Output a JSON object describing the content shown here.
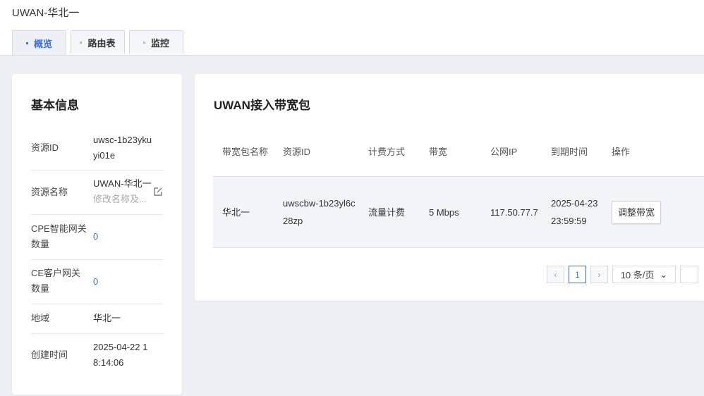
{
  "page_title": "UWAN-华北一",
  "tabs": [
    {
      "label": "概览"
    },
    {
      "label": "路由表"
    },
    {
      "label": "监控"
    }
  ],
  "basic_info": {
    "title": "基本信息",
    "resource_id_label": "资源ID",
    "resource_id_value": "uwsc-1b23ykuyi01e",
    "resource_name_label": "资源名称",
    "resource_name_value": "UWAN-华北一",
    "resource_name_hint": "修改名称及...",
    "cpe_label": "CPE智能网关数量",
    "cpe_value": "0",
    "ce_label": "CE客户网关数量",
    "ce_value": "0",
    "region_label": "地域",
    "region_value": "华北一",
    "created_label": "创建时间",
    "created_value": "2025-04-22 18:14:06"
  },
  "bandwidth": {
    "title": "UWAN接入带宽包",
    "columns": [
      "带宽包名称",
      "资源ID",
      "计费方式",
      "带宽",
      "公网IP",
      "到期时间",
      "操作"
    ],
    "rows": [
      {
        "name": "华北一",
        "resource_id": "uwscbw-1b23yl6c28zp",
        "billing": "流量计费",
        "bandwidth": "5 Mbps",
        "ip": "117.50.77.7",
        "expire": "2025-04-23 23:59:59",
        "action": "调整带宽"
      }
    ]
  },
  "pagination": {
    "page": "1",
    "page_size": "10 条/页"
  },
  "colors": {
    "accent": "#3a6fd8",
    "background": "#eef0f5"
  }
}
